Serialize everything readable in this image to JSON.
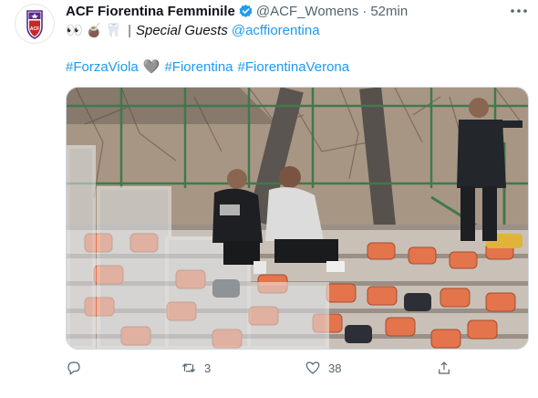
{
  "tweet": {
    "author_name": "ACF Fiorentina Femminile",
    "handle": "@ACF_Womens",
    "separator": "·",
    "time": "52min",
    "line1": {
      "emojis": [
        "👀",
        "🧉",
        "🦷"
      ],
      "separator": "|",
      "special_text": "Special Guests",
      "mention": "@acffiorentina"
    },
    "hashtags": [
      "#ForzaViola",
      "#Fiorentina",
      "#FiorentinaVerona"
    ],
    "heart_emoji": "🩶",
    "actions": {
      "retweets": "3",
      "likes": "38"
    }
  },
  "colors": {
    "link": "#1d9bf0",
    "muted": "#536471",
    "brand_purple": "#5b2a86",
    "seat_orange": "#e3744c",
    "rail_green": "#3e7a4b"
  },
  "icons": [
    "verified-badge-icon",
    "more-options-icon",
    "reply-icon",
    "retweet-icon",
    "like-icon",
    "share-icon"
  ]
}
